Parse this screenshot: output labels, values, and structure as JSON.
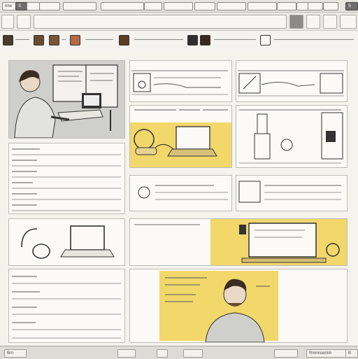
{
  "menu": {
    "items": [
      "tme",
      "S",
      "",
      "",
      "",
      "",
      "",
      "",
      "",
      "",
      "",
      "",
      "",
      "",
      "",
      "",
      "",
      "",
      "S"
    ]
  },
  "panels": {
    "p1_caption": "",
    "p2_caption": "",
    "p5_caption": "",
    "p8_caption": ""
  },
  "status": {
    "left": "Bm",
    "mid1": "",
    "mid2": "",
    "right": "Rmnnsemm",
    "right2": "B"
  },
  "colors": {
    "accent_yellow": "#f2d76b",
    "panel_bg": "#fbfaf7",
    "chrome": "#e6e5e0"
  },
  "icons": [
    "monitor-icon",
    "headphones-icon",
    "laptop-icon",
    "microscope-icon",
    "person-icon"
  ]
}
